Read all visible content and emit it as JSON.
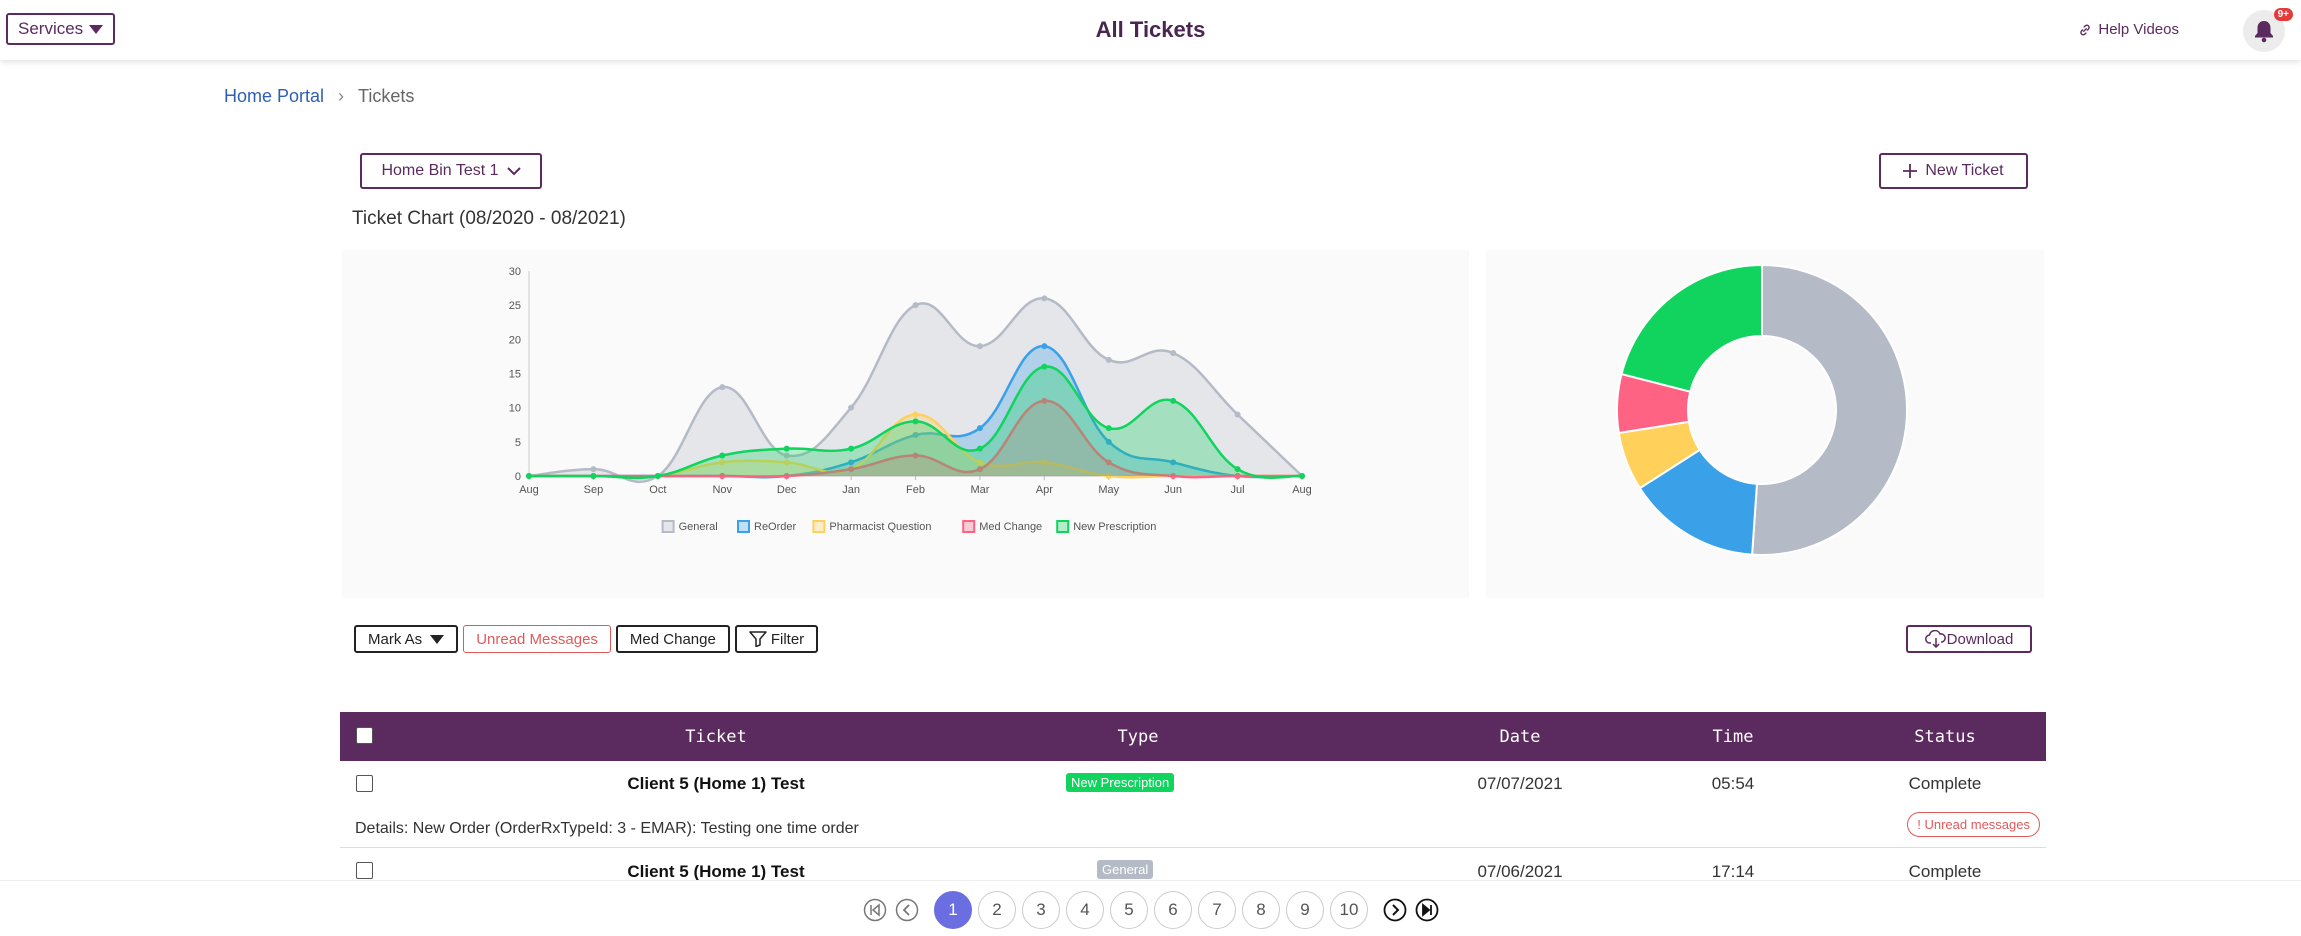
{
  "header": {
    "services_label": "Services",
    "title": "All Tickets",
    "help_label": "Help Videos",
    "notif_badge": "9+"
  },
  "breadcrumb": {
    "home": "Home Portal",
    "current": "Tickets"
  },
  "toolbar": {
    "location_select": "Home Bin Test 1",
    "new_ticket": "New Ticket"
  },
  "chart_title": "Ticket Chart (08/2020 - 08/2021)",
  "colors": {
    "brand": "#5b2a5e",
    "general": "#b4bac6",
    "reorder": "#3aa0e8",
    "pharmacist": "#ffd05a",
    "medchange": "#ff6384",
    "newrx": "#10d45e"
  },
  "chart_data": [
    {
      "type": "area",
      "categories": [
        "Aug",
        "Sep",
        "Oct",
        "Nov",
        "Dec",
        "Jan",
        "Feb",
        "Mar",
        "Apr",
        "May",
        "Jun",
        "Jul",
        "Aug"
      ],
      "ylim": [
        0,
        30
      ],
      "yticks": [
        0,
        5,
        10,
        15,
        20,
        25,
        30
      ],
      "legend_position": "bottom",
      "series": [
        {
          "name": "General",
          "color": "#b4bac6",
          "values": [
            0,
            1,
            0,
            13,
            3,
            10,
            25,
            19,
            26,
            17,
            18,
            9,
            0
          ]
        },
        {
          "name": "ReOrder",
          "color": "#3aa0e8",
          "values": [
            0,
            0,
            0,
            0,
            0,
            2,
            6,
            7,
            19,
            5,
            2,
            0,
            0
          ]
        },
        {
          "name": "Pharmacist Question",
          "color": "#ffd05a",
          "values": [
            0,
            0,
            0,
            2,
            2,
            1,
            9,
            2,
            2,
            0,
            0,
            0,
            0
          ]
        },
        {
          "name": "Med Change",
          "color": "#ff6384",
          "values": [
            0,
            0,
            0,
            0,
            0,
            1,
            3,
            1,
            11,
            2,
            0,
            0,
            0
          ]
        },
        {
          "name": "New Prescription",
          "color": "#10d45e",
          "values": [
            0,
            0,
            0,
            3,
            4,
            4,
            8,
            4,
            16,
            7,
            11,
            1,
            0
          ]
        }
      ]
    },
    {
      "type": "pie",
      "labels": [
        "General",
        "ReOrder",
        "Pharmacist Question",
        "Med Change",
        "New Prescription"
      ],
      "values": [
        141,
        41,
        18,
        18,
        58
      ],
      "colors": [
        "#b4bac6",
        "#3aa0e8",
        "#ffd05a",
        "#ff6384",
        "#10d45e"
      ]
    }
  ],
  "actions": {
    "mark_as": "Mark As",
    "unread": "Unread Messages",
    "med_change": "Med Change",
    "filter": "Filter",
    "download": "Download"
  },
  "table": {
    "headers": {
      "ticket": "Ticket",
      "type": "Type",
      "date": "Date",
      "time": "Time",
      "status": "Status"
    },
    "rows": [
      {
        "ticket": "Client 5 (Home 1) Test",
        "type": "New Prescription",
        "type_color": "#10d45e",
        "date": "07/07/2021",
        "time": "05:54",
        "status": "Complete",
        "details": "Details: New Order (OrderRxTypeId: 3 - EMAR): Testing one time order",
        "unread": "! Unread messages"
      },
      {
        "ticket": "Client 5 (Home 1) Test",
        "type": "General",
        "type_color": "#b4bac6",
        "date": "07/06/2021",
        "time": "17:14",
        "status": "Complete"
      }
    ]
  },
  "pagination": {
    "pages": [
      "1",
      "2",
      "3",
      "4",
      "5",
      "6",
      "7",
      "8",
      "9",
      "10"
    ],
    "active": "1"
  }
}
